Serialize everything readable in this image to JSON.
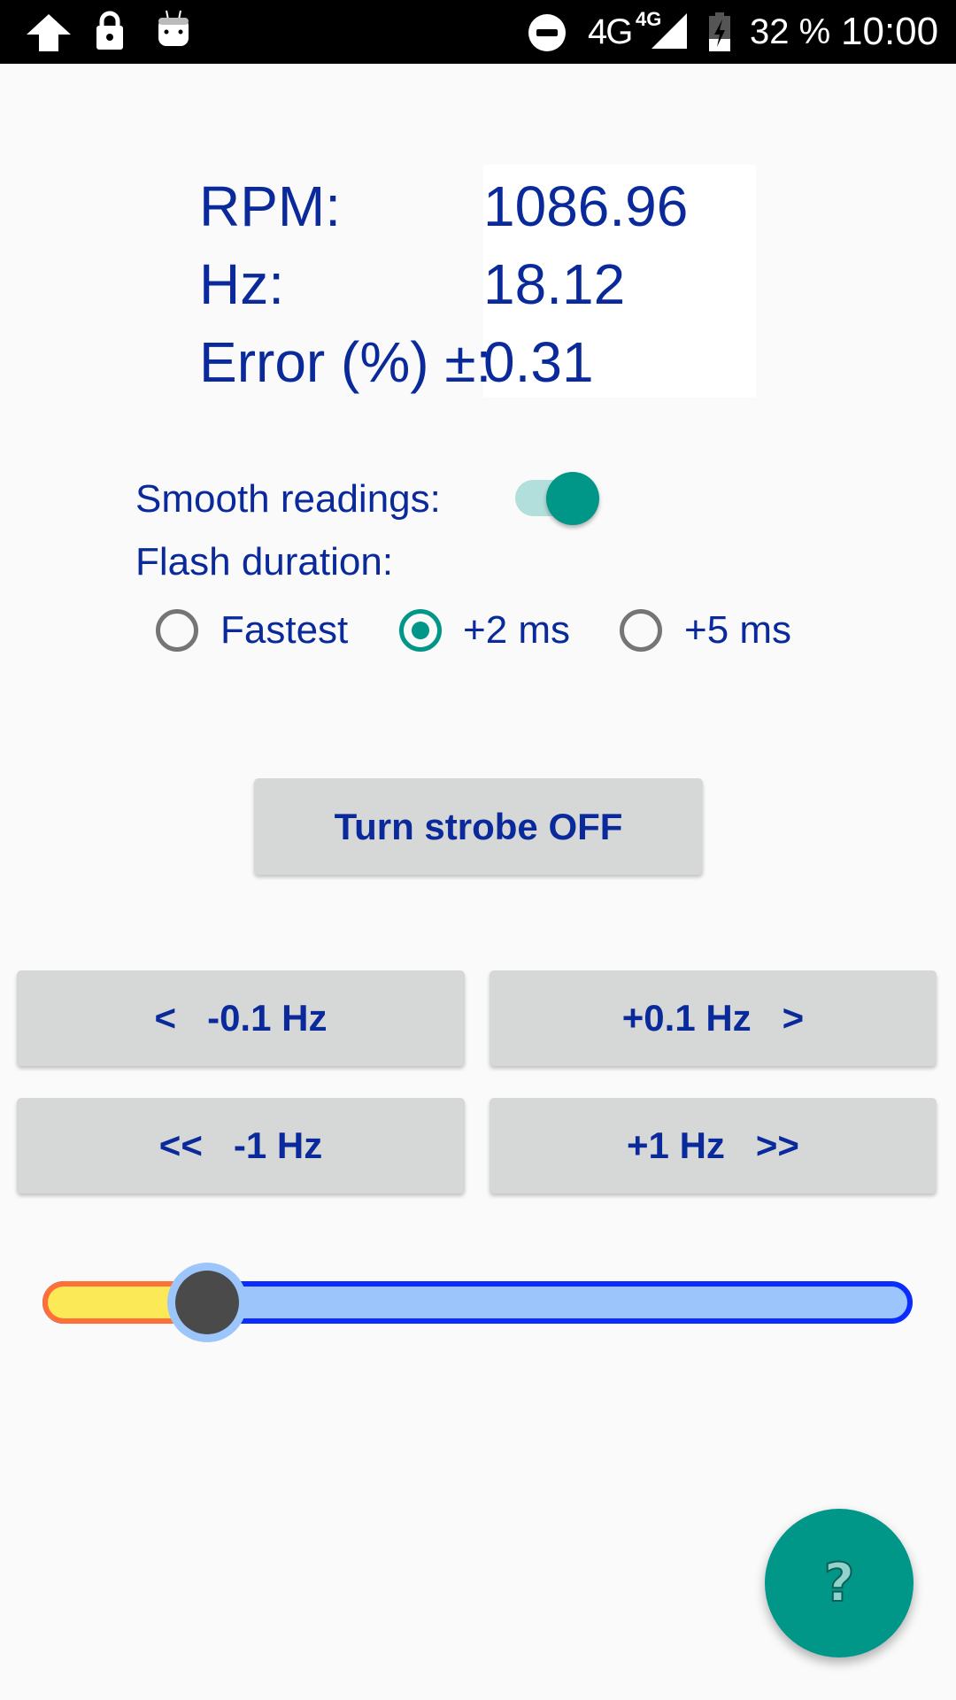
{
  "status_bar": {
    "left_icons": [
      "upload-arrow-icon",
      "lock-icon",
      "android-robot-icon"
    ],
    "network": "4G",
    "network_superscript": "4G",
    "battery_percent": "32 %",
    "time": "10:00"
  },
  "readouts": {
    "rpm_label": "RPM:",
    "rpm_value": "1086.96",
    "hz_label": "Hz:",
    "hz_value": "18.12",
    "error_label": "Error (%) ±:",
    "error_value": "0.31"
  },
  "settings": {
    "smooth_label": "Smooth readings:",
    "smooth_on": true,
    "flash_label": "Flash duration:",
    "flash_options": [
      {
        "label": "Fastest",
        "checked": false
      },
      {
        "label": "+2 ms",
        "checked": true
      },
      {
        "label": "+5 ms",
        "checked": false
      }
    ]
  },
  "buttons": {
    "strobe": "Turn strobe OFF",
    "minus_small": "<   -0.1 Hz",
    "plus_small": "+0.1 Hz   >",
    "minus_large": "<<   -1 Hz",
    "plus_large": "+1 Hz   >>"
  },
  "slider": {
    "value_fraction": 0.173
  },
  "fab": {
    "label": "?"
  },
  "colors": {
    "text": "#0a2a9c",
    "accent": "#009688",
    "slider_track": "#9cc5fc",
    "slider_border": "#0a2cff",
    "slider_fill": "#fbe957",
    "slider_fill_border": "#ff7038"
  }
}
